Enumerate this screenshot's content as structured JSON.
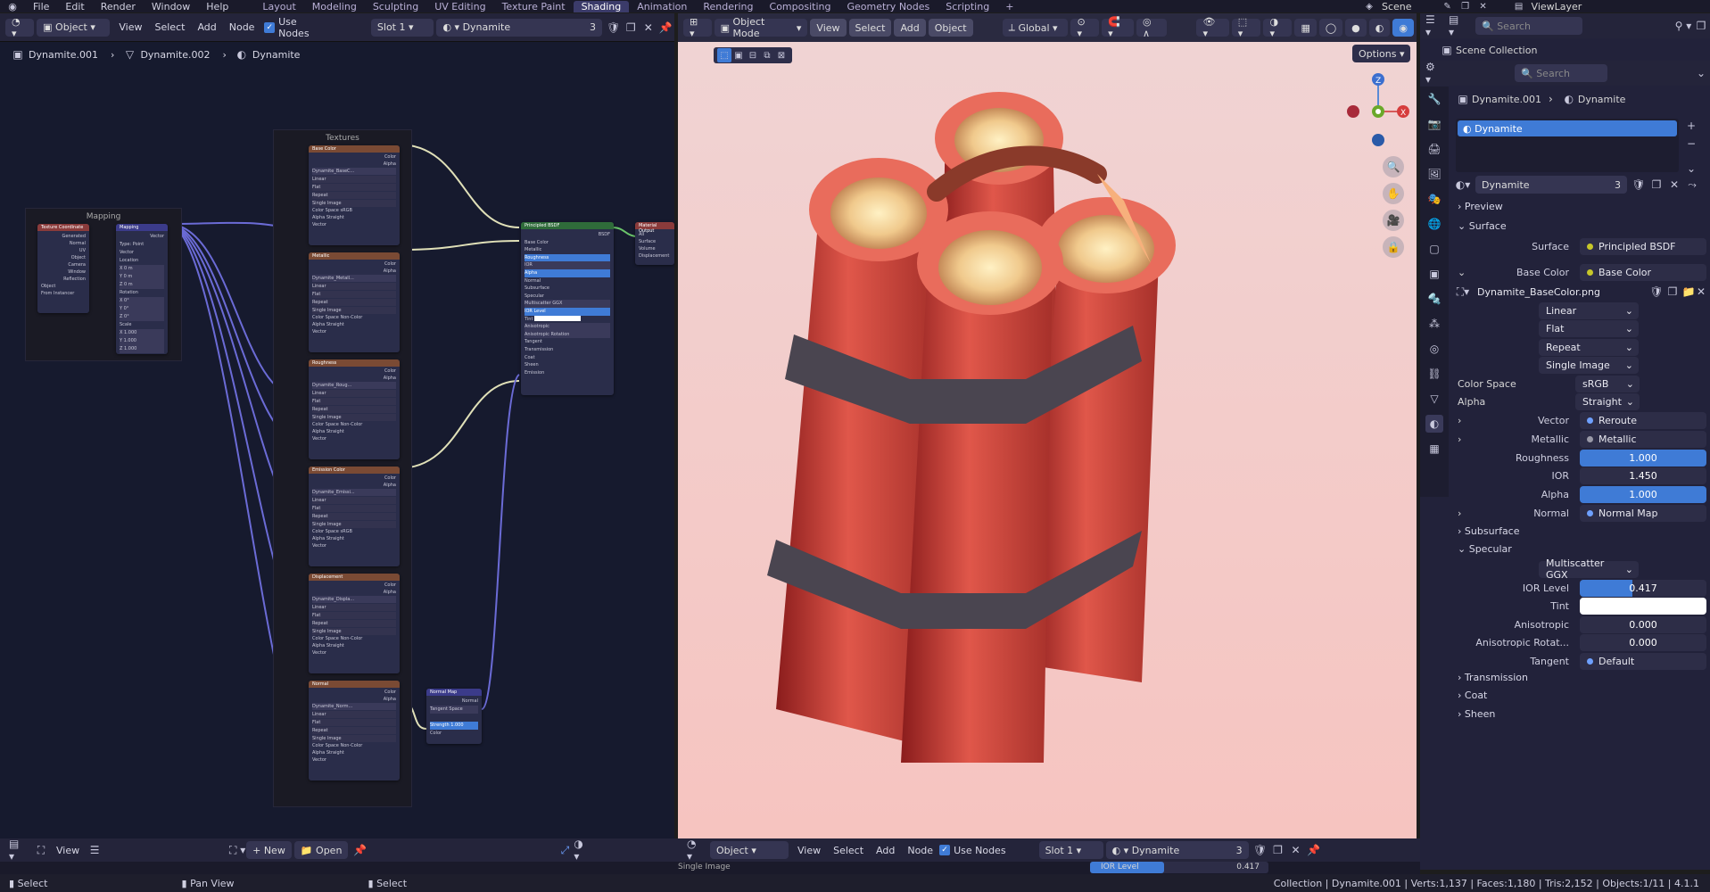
{
  "menu": [
    "File",
    "Edit",
    "Render",
    "Window",
    "Help"
  ],
  "workspaces": [
    "Layout",
    "Modeling",
    "Sculpting",
    "UV Editing",
    "Texture Paint",
    "Shading",
    "Animation",
    "Rendering",
    "Compositing",
    "Geometry Nodes",
    "Scripting"
  ],
  "active_workspace": "Shading",
  "scene_name": "Scene",
  "view_layer": "ViewLayer",
  "node_editor": {
    "object_label": "Object",
    "menus": [
      "View",
      "Select",
      "Add",
      "Node"
    ],
    "use_nodes": "Use Nodes",
    "slot": "Slot 1",
    "material": "Dynamite",
    "users": "3",
    "breadcrumb": [
      "Dynamite.001",
      "Dynamite.002",
      "Dynamite"
    ],
    "frame_textures": "Textures",
    "frame_mapping": "Mapping",
    "nodes": {
      "texcoord": {
        "title": "Texture Coordinate",
        "rows": [
          "Generated",
          "Normal",
          "UV",
          "Object",
          "Camera",
          "Window",
          "Reflection"
        ],
        "obj": "Object",
        "from_inst": "From Instancer"
      },
      "mapping": {
        "title": "Mapping",
        "type_label": "Type",
        "type": "Point",
        "vector": "Vector",
        "rows": [
          "Location",
          "X",
          "Y",
          "Z",
          "Rotation",
          "X",
          "Y",
          "Z",
          "Scale",
          "X",
          "Y",
          "Z"
        ],
        "loc": "0 m",
        "rot": "0°",
        "scale": "1.000"
      },
      "tex": [
        {
          "title": "Base Color",
          "image": "Dynamite_BaseC...",
          "cs": "sRGB",
          "alpha": "Straight"
        },
        {
          "title": "Metallic",
          "image": "Dynamite_Metall...",
          "cs": "Non-Color",
          "alpha": "Straight"
        },
        {
          "title": "Roughness",
          "image": "Dynamite_Roug...",
          "cs": "Non-Color",
          "alpha": "Straight"
        },
        {
          "title": "Emission Color",
          "image": "Dynamite_Emissi...",
          "cs": "sRGB",
          "alpha": "Straight"
        },
        {
          "title": "Displacement",
          "image": "Dynamite_Displa...",
          "cs": "Non-Color",
          "alpha": "Straight"
        },
        {
          "title": "Normal",
          "image": "Dynamite_Norm...",
          "cs": "Non-Color",
          "alpha": "Straight"
        }
      ],
      "tex_rows": [
        "Linear",
        "Flat",
        "Repeat",
        "Single Image"
      ],
      "tex_out": [
        "Color",
        "Alpha"
      ],
      "bsdf": {
        "title": "Principled BSDF",
        "out": "BSDF",
        "rows": [
          "Base Color",
          "Metallic",
          "Roughness",
          "IOR",
          "Alpha",
          "Normal",
          "Subsurface",
          "Specular",
          "Multiscatter GGX",
          "IOR Level",
          "Tint",
          "Anisotropic",
          "Anisotropic Rotation",
          "Tangent",
          "Transmission",
          "Coat",
          "Sheen",
          "Emission"
        ]
      },
      "output": {
        "title": "Material Output",
        "rows": [
          "All",
          "Surface",
          "Volume",
          "Displacement"
        ]
      },
      "normalmap": {
        "title": "Normal Map",
        "out": "Normal",
        "space": "Tangent Space",
        "strength": "Strength",
        "strength_val": "1.000",
        "color": "Color"
      }
    }
  },
  "viewport": {
    "mode": "Object Mode",
    "menus": [
      "View",
      "Select",
      "Add",
      "Object"
    ],
    "transform": "Global",
    "options": "Options"
  },
  "image_editor": {
    "view": "View",
    "new": "New",
    "open": "Open"
  },
  "viewport_footer": {
    "object_label": "Object",
    "menus": [
      "View",
      "Select",
      "Add",
      "Node"
    ],
    "use_nodes": "Use Nodes",
    "slot": "Slot 1",
    "material": "Dynamite",
    "users": "3",
    "ior_label": "IOR Level",
    "ior_value": "0.417",
    "image_tab": "Single Image"
  },
  "outliner": {
    "search": "Search",
    "scene_collection": "Scene Collection"
  },
  "properties": {
    "search": "Search",
    "breadcrumb": [
      "Dynamite.001",
      "Dynamite"
    ],
    "slot_item": "Dynamite",
    "material_name": "Dynamite",
    "material_users": "3",
    "panels": {
      "preview": "Preview",
      "surface": "Surface"
    },
    "surface_label": "Surface",
    "surface_value": "Principled BSDF",
    "base_color_label": "Base Color",
    "base_color_value": "Base Color",
    "image_name": "Dynamite_BaseColor.png",
    "interp": "Linear",
    "proj": "Flat",
    "ext": "Repeat",
    "source": "Single Image",
    "color_space_label": "Color Space",
    "color_space": "sRGB",
    "alpha_label": "Alpha",
    "alpha_mode": "Straight",
    "vector_label": "Vector",
    "vector_value": "Reroute",
    "metallic_label": "Metallic",
    "metallic_value": "Metallic",
    "roughness_label": "Roughness",
    "roughness_value": "1.000",
    "ior_label": "IOR",
    "ior_value": "1.450",
    "alpha2_label": "Alpha",
    "alpha2_value": "1.000",
    "normal_label": "Normal",
    "normal_value": "Normal Map",
    "subsurface": "Subsurface",
    "specular": "Specular",
    "distribution": "Multiscatter GGX",
    "ior_level_label": "IOR Level",
    "ior_level_value": "0.417",
    "ior_level_fill": 0.417,
    "tint_label": "Tint",
    "aniso_label": "Anisotropic",
    "aniso_value": "0.000",
    "aniso_rot_label": "Anisotropic Rotat...",
    "aniso_rot_value": "0.000",
    "tangent_label": "Tangent",
    "tangent_value": "Default",
    "transmission": "Transmission",
    "coat": "Coat",
    "sheen": "Sheen"
  },
  "status": {
    "select": "Select",
    "pan": "Pan View",
    "select2": "Select",
    "info": "Collection | Dynamite.001 | Verts:1,137 | Faces:1,180 | Tris:2,152 | Objects:1/11 | 4.1.1"
  },
  "colors": {
    "accent": "#3f7bd6",
    "header": "#24243a",
    "node_bg": "#161a2e"
  }
}
